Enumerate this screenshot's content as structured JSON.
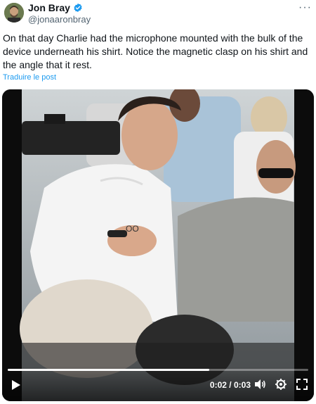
{
  "author": {
    "name": "Jon Bray",
    "handle": "@jonaaronbray",
    "verified": true
  },
  "tweet": {
    "text": "On that day Charlie had the microphone mounted with the bulk of the device underneath his shirt. Notice the magnetic clasp on his shirt and the angle that it rest.",
    "translate_label": "Traduire le post"
  },
  "video": {
    "shirt_print": "OO",
    "current_time": "0:02",
    "separator": "/",
    "duration": "0:03",
    "progress": 0.67,
    "controls": [
      "play-icon",
      "volume-icon",
      "settings-icon",
      "fullscreen-icon"
    ]
  },
  "colors": {
    "link": "#1d9bf0",
    "verified": "#1d9bf0",
    "secondary_text": "#536471"
  }
}
